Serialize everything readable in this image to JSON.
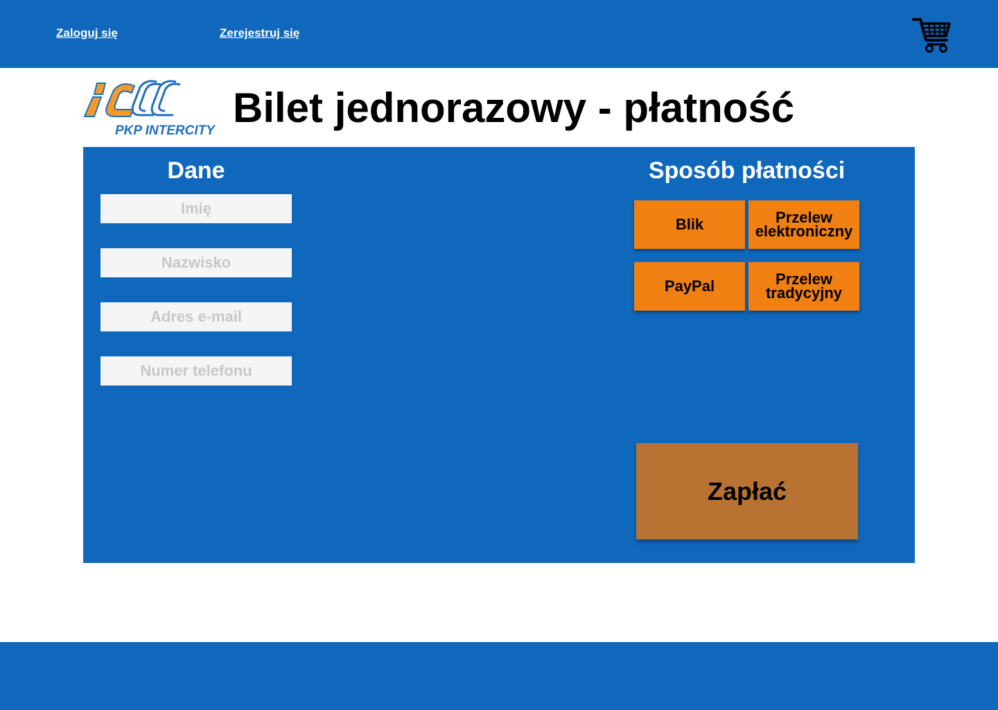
{
  "header": {
    "login_link": "Zaloguj się",
    "register_link": "Zerejestruj się",
    "cart_icon": "shopping-cart-icon"
  },
  "logo": {
    "text": "PKP INTERCITY",
    "mark": "iC"
  },
  "page": {
    "title": "Bilet jednorazowy - płatność"
  },
  "data_section": {
    "title": "Dane",
    "fields": [
      {
        "placeholder": "Imię",
        "value": ""
      },
      {
        "placeholder": "Nazwisko",
        "value": ""
      },
      {
        "placeholder": "Adres e-mail",
        "value": ""
      },
      {
        "placeholder": "Numer telefonu",
        "value": ""
      }
    ]
  },
  "payment_section": {
    "title": "Sposób płatności",
    "methods": [
      "Blik",
      "Przelew elektroniczny",
      "PayPal",
      "Przelew tradycyjny"
    ],
    "pay_button": "Zapłać"
  },
  "colors": {
    "brand_blue": "#0f68bc",
    "method_orange": "#f18013",
    "pay_brown": "#b87333",
    "logo_orange": "#f39a2b",
    "logo_blue": "#1e6fbf"
  }
}
